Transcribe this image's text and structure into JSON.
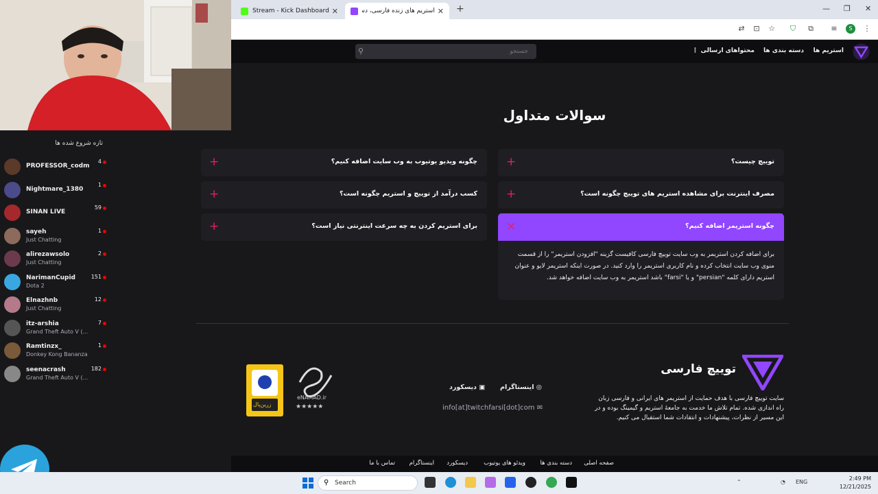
{
  "browser": {
    "tabs": [
      {
        "label": "Stream - Kick Dashboard",
        "active": false,
        "favicon_color": "#53fc18"
      },
      {
        "label": "استریم های زنده فارسی، دسته بن...",
        "active": true,
        "favicon_color": "#9146ff"
      }
    ]
  },
  "site": {
    "nav": {
      "streams": "استریم ها",
      "categories": "دسته بندی ها",
      "submitted": "محتواهای ارسالی",
      "more": "⋮"
    },
    "search": {
      "placeholder": "جستجو"
    },
    "sidebar": {
      "title": "تازه شروع شده ها",
      "channels": [
        {
          "name": "PROFESSOR_codm",
          "category": "",
          "viewers": "4",
          "color": "#5b3a2a"
        },
        {
          "name": "Nightmare_1380",
          "category": "",
          "viewers": "1",
          "color": "#4b4a8a"
        },
        {
          "name": "SINAN LIVE",
          "category": "",
          "viewers": "59",
          "color": "#a5282c"
        },
        {
          "name": "sayeh",
          "category": "Just Chatting",
          "viewers": "1",
          "color": "#8c6b5c"
        },
        {
          "name": "alirezawsolo",
          "category": "Just Chatting",
          "viewers": "2",
          "color": "#6b3b4b"
        },
        {
          "name": "NarimanCupid",
          "category": "Dota 2",
          "viewers": "151",
          "color": "#3aa8e0"
        },
        {
          "name": "Elnazhnb",
          "category": "Just Chatting",
          "viewers": "12",
          "color": "#b57a8a"
        },
        {
          "name": "itz-arshia",
          "category": "Grand Theft Auto V (...",
          "viewers": "7",
          "color": "#555555"
        },
        {
          "name": "Ramtinzx_",
          "category": "Donkey Kong Bananza",
          "viewers": "1",
          "color": "#7a5a3a"
        },
        {
          "name": "seenacrash",
          "category": "Grand Theft Auto V (...",
          "viewers": "182",
          "color": "#888888"
        }
      ]
    },
    "faq": {
      "title": "سوالات متداول",
      "items": [
        {
          "q": "توییچ چیست؟"
        },
        {
          "q": "چگونه ویدیو یوتیوب به وب سایت اضافه کنیم؟"
        },
        {
          "q": "مصرف اینترنت برای مشاهده استریم های توییچ چگونه است؟"
        },
        {
          "q": "کسب درآمد از توییچ و استریم چگونه است؟"
        },
        {
          "q": "چگونه استریمر اضافه کنیم؟"
        },
        {
          "q": "برای استریم کردن به چه سرعت اینترنتی نیاز است؟"
        }
      ],
      "answer": "برای اضافه کردن استریمر به وب سایت توییچ فارسی کافیست گزینه \"افزودن استریمر\" را از قسمت منوی وب سایت انتخاب کرده و نام کاربری استریمر را وارد کنید. در صورت اینکه استریمر لایو و عنوان استریم  دارای کلمه \"persian\" و یا \"farsi\" باشد استریمر به وب سایت اضافه خواهد شد.",
      "plus": "+",
      "close": "×"
    },
    "footer": {
      "brand": "توییچ فارسی",
      "description": "سایت توییچ فارسی با هدف حمایت از استریمر های ایرانی و فارسی زبان راه اندازی شده. تمام تلاش ما خدمت به جامعهٔ استریم و گیمینگ بوده و در این مسیر از نظرات، پیشنهادات و انتقادات شما استقبال می کنیم.",
      "instagram": "اینستاگرام",
      "discord": "دیسکورد",
      "email": "info[at]twitchfarsi[dot]com",
      "enamad_text": "eNAMAD.ir",
      "zarinpal_text": "زرین‌پال",
      "bottom_nav": [
        "صفحه اصلی",
        "دسته بندی ها",
        "ویدئو های یوتیوب",
        "دیسکورد",
        "اینستاگرام",
        "تماس با ما"
      ]
    }
  },
  "taskbar": {
    "search_label": "Search",
    "lang": "ENG",
    "time": "2:49 PM",
    "date": "12/21/2025"
  }
}
